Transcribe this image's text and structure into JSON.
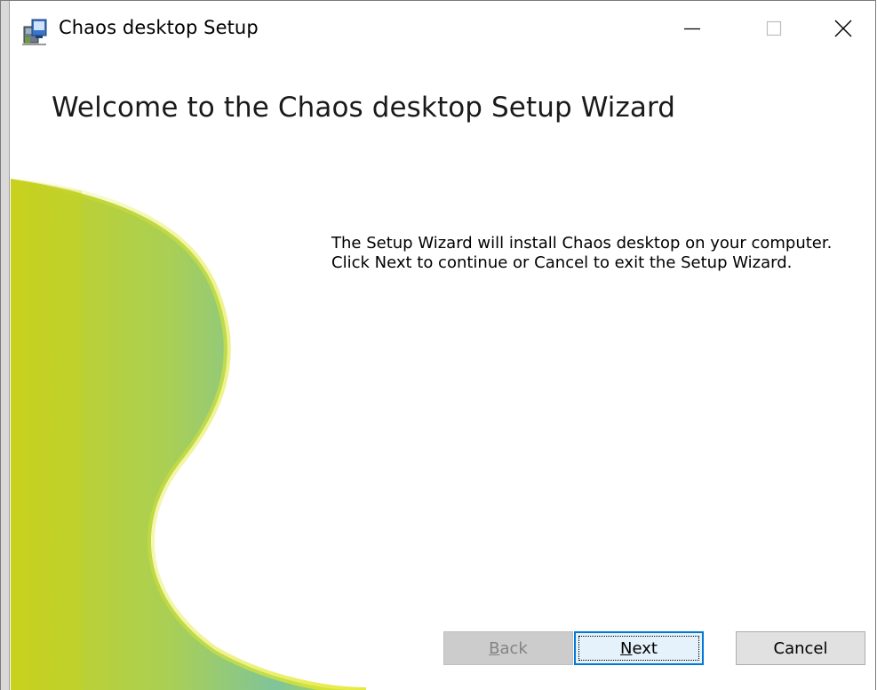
{
  "window": {
    "title": "Chaos desktop Setup",
    "icon": "installer-package-icon",
    "controls": {
      "minimize_icon": "minimize-icon",
      "maximize_icon": "maximize-icon",
      "close_icon": "close-icon"
    }
  },
  "wizard": {
    "heading": "Welcome to the Chaos desktop Setup Wizard",
    "description": "The Setup Wizard will install Chaos desktop on your computer. Click Next to continue or Cancel to exit the Setup Wizard."
  },
  "buttons": {
    "back": {
      "label_mnemonic": "B",
      "label_rest": "ack",
      "enabled": false
    },
    "next": {
      "label_mnemonic": "N",
      "label_rest": "ext",
      "focused": true
    },
    "cancel": {
      "label": "Cancel"
    }
  },
  "colors": {
    "art_yellow": "#c8d21e",
    "art_teal": "#7fc49a",
    "focus_blue": "#0078d7"
  }
}
